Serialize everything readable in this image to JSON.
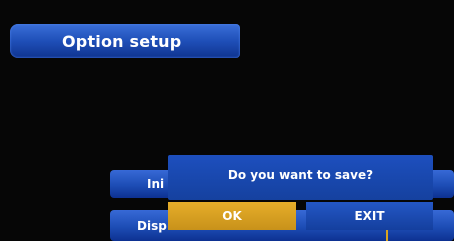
{
  "screen": {
    "title": "Option setup"
  },
  "menu": {
    "items": [
      {
        "label": "Ini"
      },
      {
        "label": "Disp"
      }
    ]
  },
  "dialog": {
    "message": "Do you want to save?",
    "ok_label": "OK",
    "exit_label": "EXIT"
  },
  "colors": {
    "background": "#060606",
    "menu_blue": "#1d4db5",
    "dialog_blue": "#1d4fbe",
    "selected_button": "#e6ae2a",
    "text": "#ffffff"
  }
}
